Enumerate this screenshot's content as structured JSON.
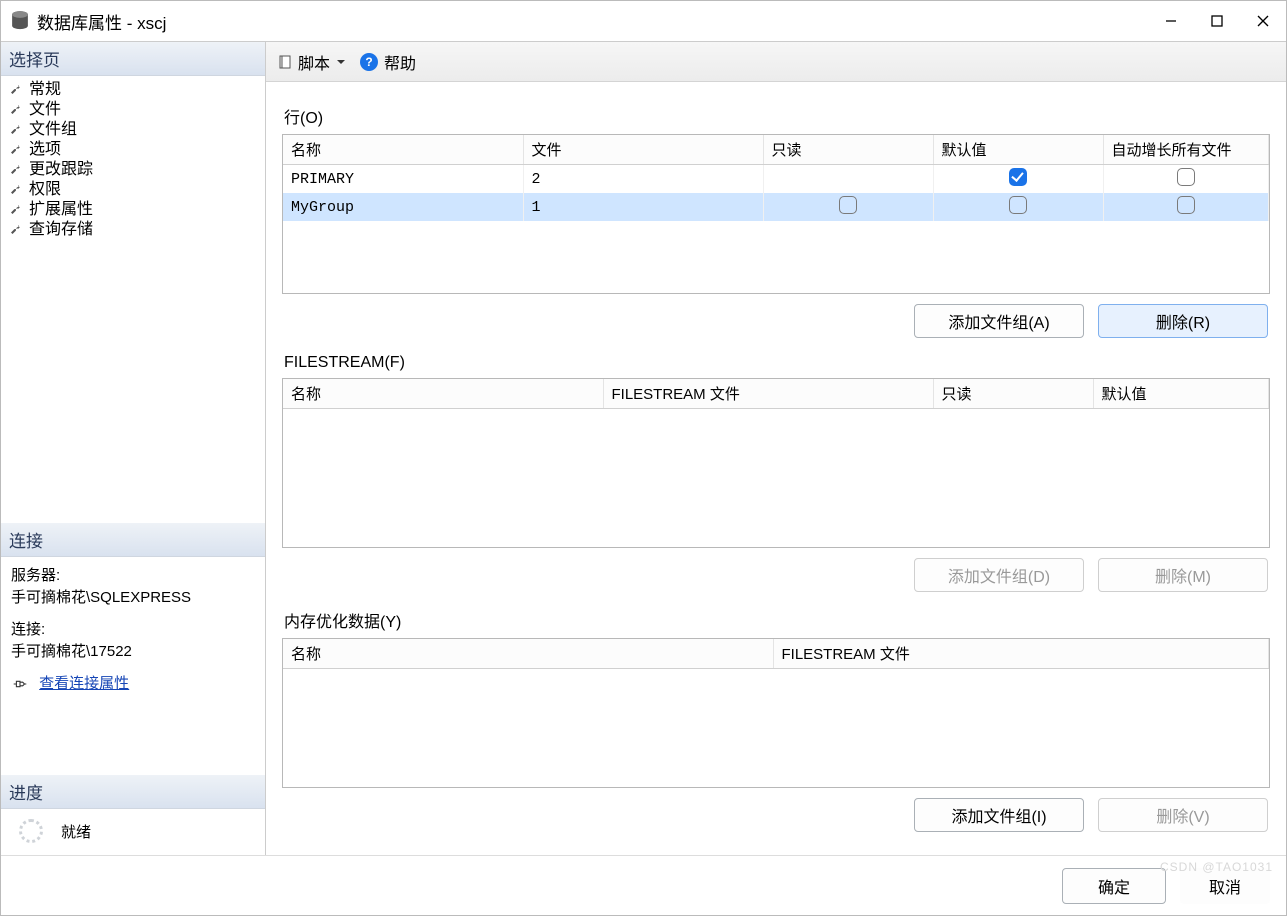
{
  "window": {
    "title": "数据库属性 - xscj"
  },
  "sidebar": {
    "pages_header": "选择页",
    "items": [
      {
        "label": "常规"
      },
      {
        "label": "文件"
      },
      {
        "label": "文件组"
      },
      {
        "label": "选项"
      },
      {
        "label": "更改跟踪"
      },
      {
        "label": "权限"
      },
      {
        "label": "扩展属性"
      },
      {
        "label": "查询存储"
      }
    ],
    "connection_header": "连接",
    "server_label": "服务器:",
    "server_value": "手可摘棉花\\SQLEXPRESS",
    "conn_label": "连接:",
    "conn_value": "手可摘棉花\\17522",
    "view_conn_props": "查看连接属性",
    "progress_header": "进度",
    "progress_status": "就绪"
  },
  "toolbar": {
    "script": "脚本",
    "help": "帮助"
  },
  "rows_section": {
    "title": "行(O)",
    "headers": {
      "name": "名称",
      "files": "文件",
      "readonly": "只读",
      "default": "默认值",
      "autogrow": "自动增长所有文件"
    },
    "data": [
      {
        "name": "PRIMARY",
        "files": "2",
        "readonly": null,
        "default": true,
        "autogrow": false,
        "selected": false
      },
      {
        "name": "MyGroup",
        "files": "1",
        "readonly": false,
        "default": false,
        "autogrow": false,
        "selected": true
      }
    ],
    "add_btn": "添加文件组(A)",
    "del_btn": "删除(R)"
  },
  "fs_section": {
    "title": "FILESTREAM(F)",
    "headers": {
      "name": "名称",
      "fsfile": "FILESTREAM 文件",
      "readonly": "只读",
      "default": "默认值"
    },
    "add_btn": "添加文件组(D)",
    "del_btn": "删除(M)"
  },
  "mem_section": {
    "title": "内存优化数据(Y)",
    "headers": {
      "name": "名称",
      "fsfile": "FILESTREAM 文件"
    },
    "add_btn": "添加文件组(I)",
    "del_btn": "删除(V)"
  },
  "footer": {
    "ok": "确定",
    "cancel": "取消"
  },
  "watermark": "CSDN @TAO1031"
}
